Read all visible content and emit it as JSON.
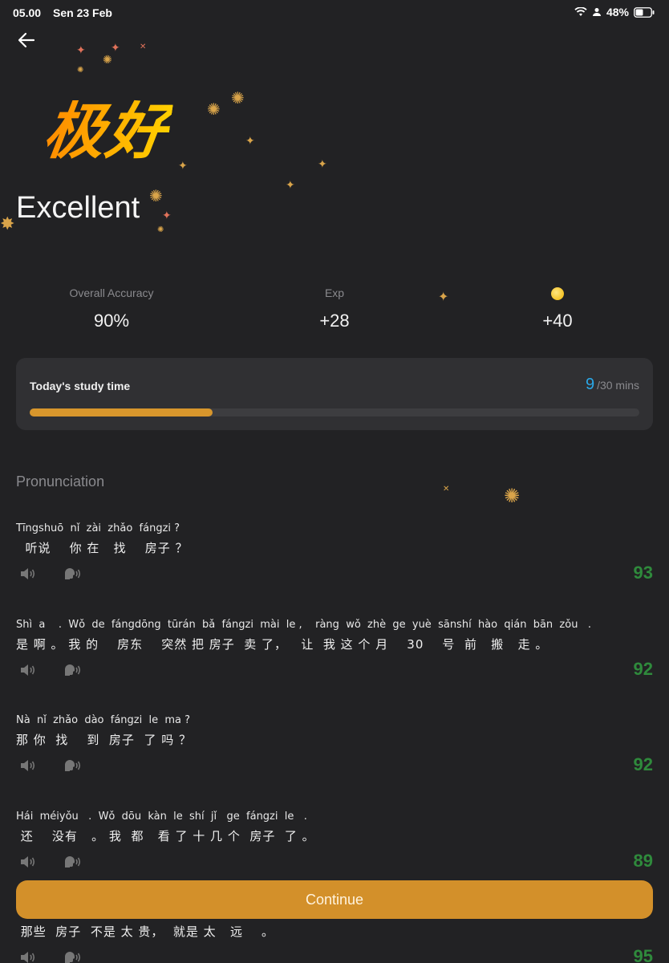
{
  "status_bar": {
    "time": "05.00",
    "date": "Sen 23 Feb",
    "battery": "48%"
  },
  "hero": {
    "badge_text": "极好",
    "title": "Excellent"
  },
  "stats": [
    {
      "label": "Overall Accuracy",
      "value": "90%"
    },
    {
      "label": "Exp",
      "value": "+28"
    },
    {
      "label": "",
      "value": "+40",
      "icon": "coin-icon"
    }
  ],
  "study": {
    "label": "Today's study time",
    "current": "9",
    "goal": "/30 mins",
    "progress_fraction": 0.3
  },
  "section_title": "Pronunciation",
  "items": [
    {
      "pinyin": "Tīngshuō  nǐ  zài  zhǎo  fángzi ?",
      "hanzi": "  听说    你 在   找    房子 ？",
      "score": "93"
    },
    {
      "pinyin": "Shì  a    .  Wǒ  de  fángdōng  tūrán  bǎ  fángzi  mài  le ,    ràng  wǒ  zhè  ge  yuè  sānshí  hào  qián  bān  zǒu   .",
      "hanzi": "是 啊 。 我 的    房东    突然 把 房子  卖 了，   让  我 这 个 月    30    号  前   搬   走 。",
      "score": "92"
    },
    {
      "pinyin": "Nà  nǐ  zhǎo  dào  fángzi  le  ma ?",
      "hanzi": "那 你  找    到  房子  了 吗 ？",
      "score": "92"
    },
    {
      "pinyin": "Hái  méiyǒu   .  Wǒ  dōu  kàn  le  shí  jǐ   ge  fángzi  le   .",
      "hanzi": " 还    没有   。 我  都   看 了 十 几 个  房子  了 。",
      "score": "89"
    },
    {
      "pinyin": "",
      "hanzi": " 那些  房子  不是 太 贵，  就是 太   远    。",
      "score": "95"
    }
  ],
  "continue_label": "Continue"
}
